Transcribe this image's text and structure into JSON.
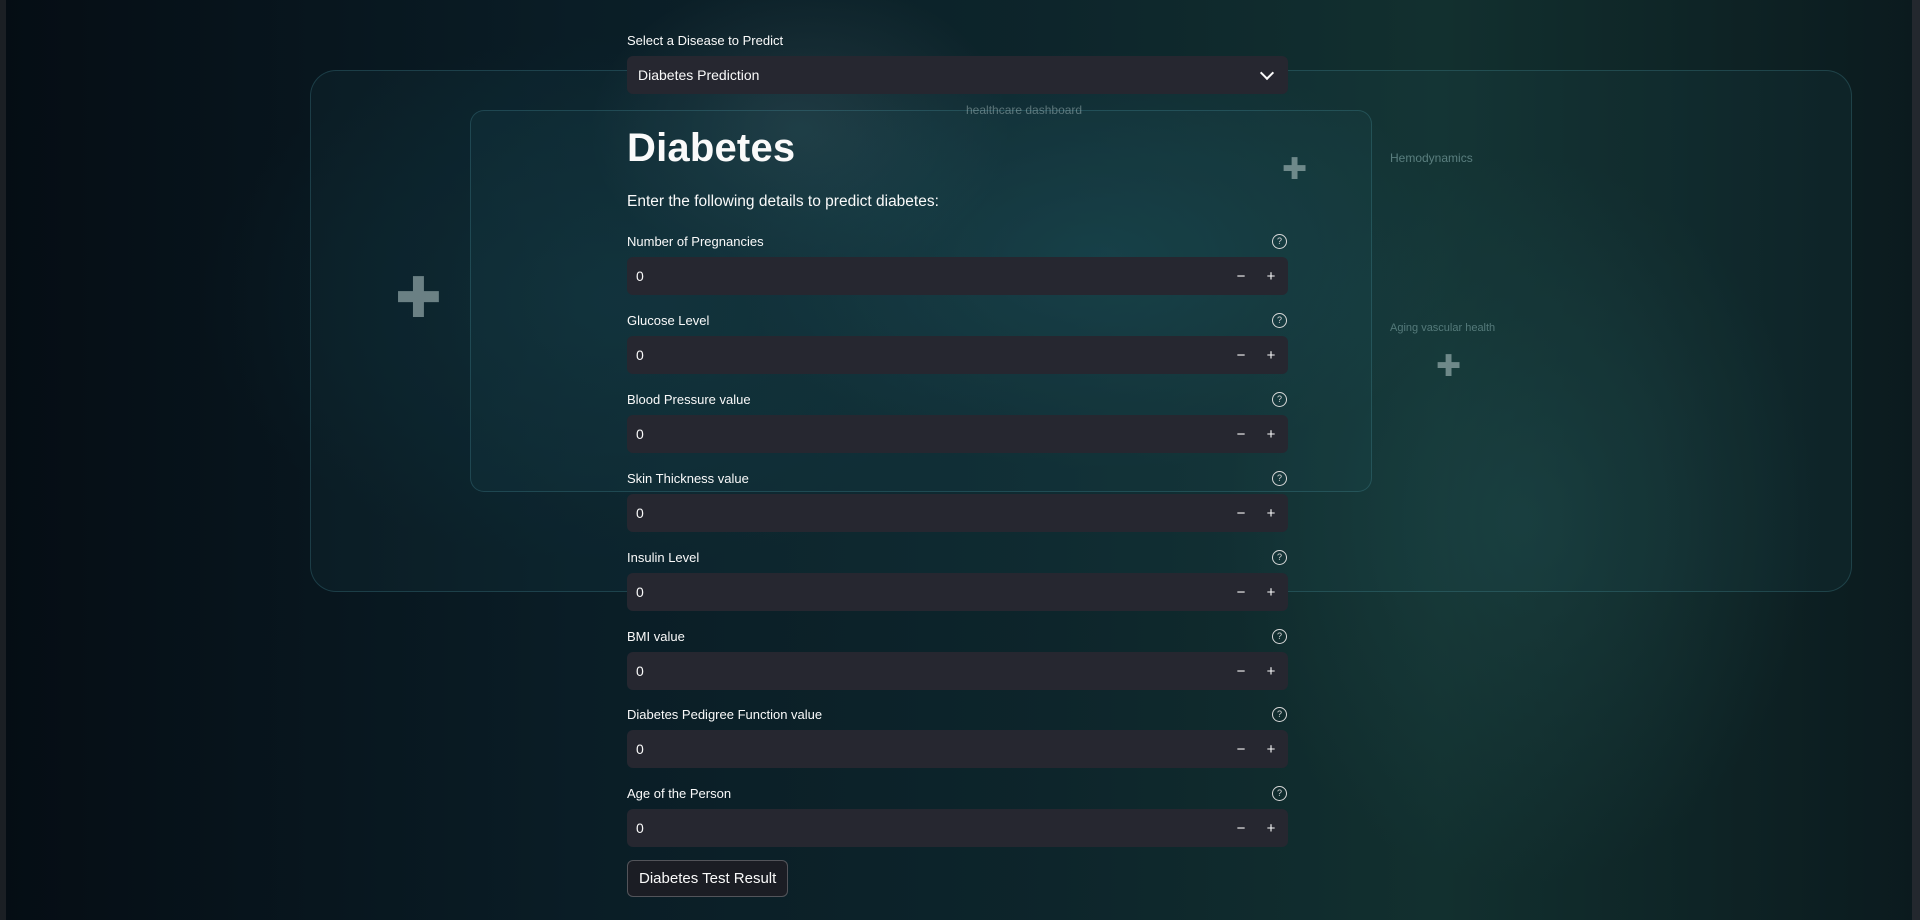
{
  "disease_select": {
    "label": "Select a Disease to Predict",
    "selected": "Diabetes Prediction"
  },
  "page": {
    "title": "Diabetes",
    "subtitle": "Enter the following details to predict diabetes:"
  },
  "fields": [
    {
      "label": "Number of Pregnancies",
      "value": "0"
    },
    {
      "label": "Glucose Level",
      "value": "0"
    },
    {
      "label": "Blood Pressure value",
      "value": "0"
    },
    {
      "label": "Skin Thickness value",
      "value": "0"
    },
    {
      "label": "Insulin Level",
      "value": "0"
    },
    {
      "label": "BMI value",
      "value": "0"
    },
    {
      "label": "Diabetes Pedigree Function value",
      "value": "0"
    },
    {
      "label": "Age of the Person",
      "value": "0"
    }
  ],
  "stepper": {
    "minus": "−",
    "plus": "+",
    "help": "?"
  },
  "submit_button": "Diabetes Test Result",
  "background": {
    "dashboard_caption": "healthcare dashboard",
    "panel_title": "Hemodynamics",
    "panel_subtitle": "Aging vascular health"
  }
}
